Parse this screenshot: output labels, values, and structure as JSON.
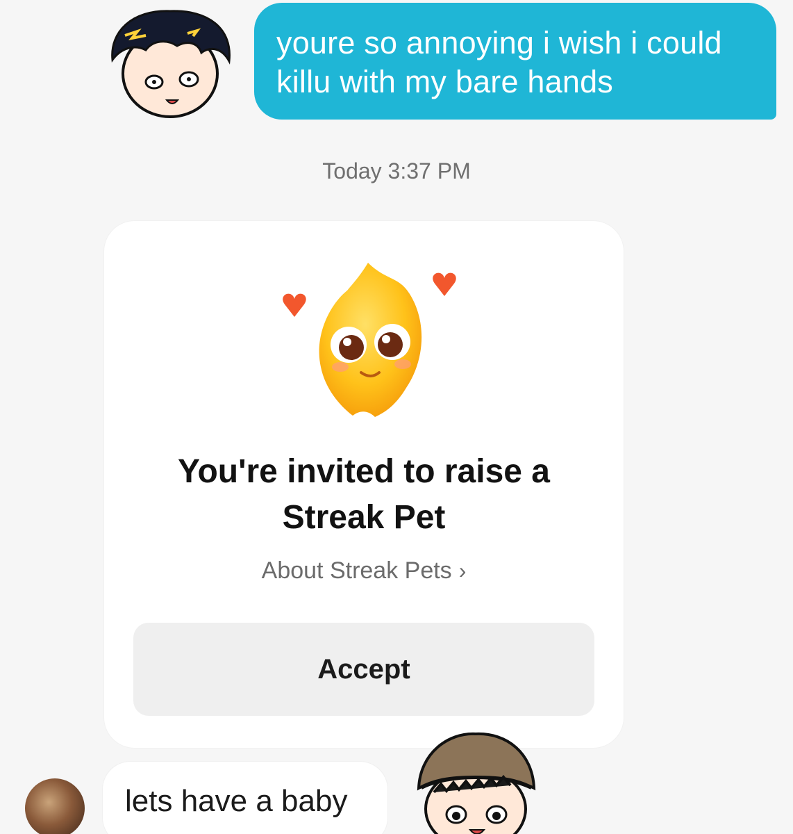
{
  "messages": {
    "outgoing": {
      "line1": "youre so annoying i wish i could",
      "line2": "killu with my bare hands"
    },
    "timestamp": "Today 3:37 PM",
    "incoming": {
      "text": "lets have a baby"
    }
  },
  "streak_card": {
    "title_line1": "You're invited to raise a",
    "title_line2": "Streak Pet",
    "link_label": "About Streak Pets",
    "accept_label": "Accept",
    "pet_icon": "streak-pet-flame-icon"
  },
  "colors": {
    "outgoing_bubble": "#1fb6d6",
    "background": "#f6f6f6",
    "button": "#efefef"
  }
}
